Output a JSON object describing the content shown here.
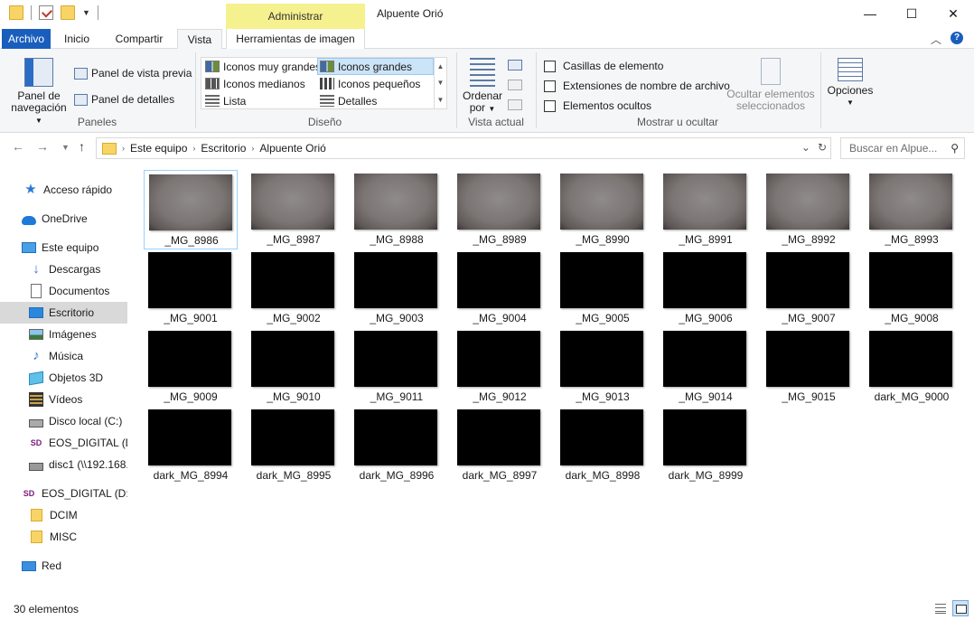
{
  "window": {
    "title": "Alpuente Orió",
    "context_tab_group": "Administrar",
    "controls": {
      "minimize": "—",
      "maximize": "☐",
      "close": "✕"
    }
  },
  "ribbon_tabs": {
    "file": "Archivo",
    "home": "Inicio",
    "share": "Compartir",
    "view": "Vista",
    "image_tools": "Herramientas de imagen"
  },
  "ribbon": {
    "panes": {
      "label": "Paneles",
      "nav_pane_line1": "Panel de",
      "nav_pane_line2": "navegación",
      "preview_pane": "Panel de vista previa",
      "details_pane": "Panel de detalles"
    },
    "layout": {
      "label": "Diseño",
      "items": [
        "Iconos muy grandes",
        "Iconos grandes",
        "Iconos medianos",
        "Iconos pequeños",
        "Lista",
        "Detalles"
      ],
      "selected": "Iconos grandes"
    },
    "current_view": {
      "label": "Vista actual",
      "sort_line1": "Ordenar",
      "sort_line2": "por"
    },
    "show_hide": {
      "label": "Mostrar u ocultar",
      "item_checkboxes": "Casillas de elemento",
      "file_extensions": "Extensiones de nombre de archivo",
      "hidden_items": "Elementos ocultos",
      "hide_selected_line1": "Ocultar elementos",
      "hide_selected_line2": "seleccionados"
    },
    "options": "Opciones"
  },
  "address": {
    "crumbs": [
      "Este equipo",
      "Escritorio",
      "Alpuente Orió"
    ],
    "search_placeholder": "Buscar en Alpue..."
  },
  "sidebar": {
    "items": [
      {
        "label": "Acceso rápido",
        "icon": "star-icon"
      },
      {
        "label": "OneDrive",
        "icon": "cloud-icon"
      },
      {
        "label": "Este equipo",
        "icon": "computer-icon"
      },
      {
        "label": "Descargas",
        "icon": "download-icon"
      },
      {
        "label": "Documentos",
        "icon": "document-icon"
      },
      {
        "label": "Escritorio",
        "icon": "desktop-icon"
      },
      {
        "label": "Imágenes",
        "icon": "pictures-icon"
      },
      {
        "label": "Música",
        "icon": "music-icon"
      },
      {
        "label": "Objetos 3D",
        "icon": "3d-objects-icon"
      },
      {
        "label": "Vídeos",
        "icon": "video-icon"
      },
      {
        "label": "Disco local (C:)",
        "icon": "drive-icon"
      },
      {
        "label": "EOS_DIGITAL (D:)",
        "icon": "sd-card-icon"
      },
      {
        "label": "disc1 (\\\\192.168.",
        "icon": "network-drive-icon"
      },
      {
        "label": "EOS_DIGITAL (D:)",
        "icon": "sd-card-icon"
      },
      {
        "label": "DCIM",
        "icon": "folder-icon"
      },
      {
        "label": "MISC",
        "icon": "folder-icon"
      },
      {
        "label": "Red",
        "icon": "network-icon"
      }
    ],
    "selected": "Escritorio"
  },
  "files": [
    {
      "name": "_MG_8986",
      "thumb": "light"
    },
    {
      "name": "_MG_8987",
      "thumb": "light"
    },
    {
      "name": "_MG_8988",
      "thumb": "light"
    },
    {
      "name": "_MG_8989",
      "thumb": "light"
    },
    {
      "name": "_MG_8990",
      "thumb": "light"
    },
    {
      "name": "_MG_8991",
      "thumb": "light"
    },
    {
      "name": "_MG_8992",
      "thumb": "light"
    },
    {
      "name": "_MG_8993",
      "thumb": "light"
    },
    {
      "name": "_MG_9001",
      "thumb": "dark"
    },
    {
      "name": "_MG_9002",
      "thumb": "dark"
    },
    {
      "name": "_MG_9003",
      "thumb": "dark"
    },
    {
      "name": "_MG_9004",
      "thumb": "dark"
    },
    {
      "name": "_MG_9005",
      "thumb": "dark"
    },
    {
      "name": "_MG_9006",
      "thumb": "dark"
    },
    {
      "name": "_MG_9007",
      "thumb": "dark"
    },
    {
      "name": "_MG_9008",
      "thumb": "dark"
    },
    {
      "name": "_MG_9009",
      "thumb": "dark"
    },
    {
      "name": "_MG_9010",
      "thumb": "dark"
    },
    {
      "name": "_MG_9011",
      "thumb": "dark"
    },
    {
      "name": "_MG_9012",
      "thumb": "dark"
    },
    {
      "name": "_MG_9013",
      "thumb": "dark"
    },
    {
      "name": "_MG_9014",
      "thumb": "dark"
    },
    {
      "name": "_MG_9015",
      "thumb": "dark"
    },
    {
      "name": "dark_MG_9000",
      "thumb": "dark"
    },
    {
      "name": "dark_MG_8994",
      "thumb": "dark"
    },
    {
      "name": "dark_MG_8995",
      "thumb": "dark"
    },
    {
      "name": "dark_MG_8996",
      "thumb": "dark"
    },
    {
      "name": "dark_MG_8997",
      "thumb": "dark"
    },
    {
      "name": "dark_MG_8998",
      "thumb": "dark"
    },
    {
      "name": "dark_MG_8999",
      "thumb": "dark"
    }
  ],
  "focused_file": "_MG_8986",
  "status": {
    "item_count": "30 elementos"
  },
  "colors": {
    "accent": "#1a5ebd",
    "context_tab": "#f5f18f",
    "selection": "#cce4f7"
  }
}
